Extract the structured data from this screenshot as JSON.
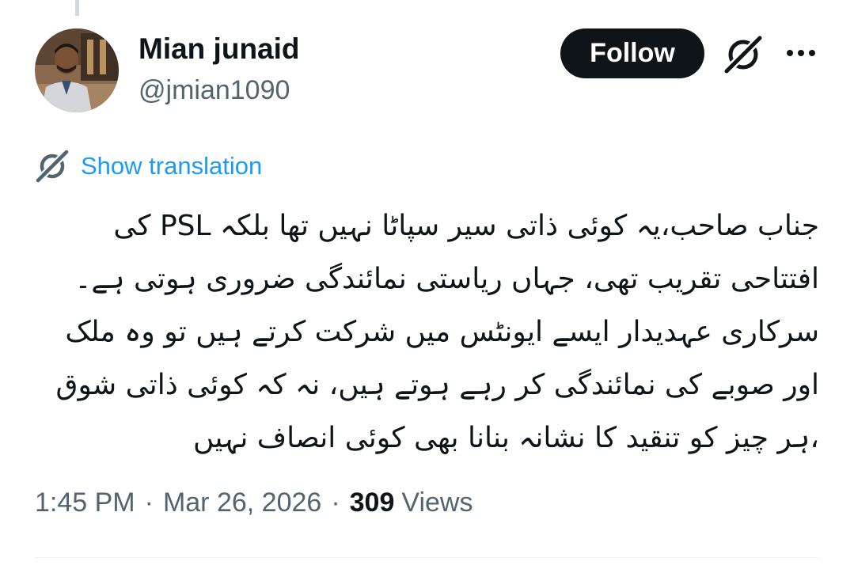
{
  "author": {
    "display_name": "Mian junaid",
    "handle": "@jmian1090"
  },
  "actions": {
    "follow_label": "Follow",
    "grok_icon": "grok-icon",
    "more_icon": "more-icon"
  },
  "translation": {
    "label": "Show translation",
    "icon": "translate-icon"
  },
  "tweet": {
    "lines": [
      "جناب صاحب،یہ کوئی ذاتی سیر سپاٹا نہیں تھا بلکہ PSL کی",
      "افتتاحی تقریب تھی، جہاں ریاستی نمائندگی ضروری ہوتی ہے۔",
      "سرکاری عہدیدار ایسے ایونٹس میں شرکت کرتے ہیں تو وہ ملک",
      "اور صوبے کی نمائندگی کر رہے ہوتے ہیں، نہ کہ کوئی ذاتی شوق",
      "،ہر چیز کو تنقید کا نشانہ بنانا بھی کوئی انصاف نہیں"
    ]
  },
  "meta": {
    "time": "1:45 PM",
    "separator": "·",
    "date": "Mar 26, 2026",
    "views_count": "309",
    "views_label": "Views"
  },
  "colors": {
    "text_primary": "#0f1419",
    "text_secondary": "#536471",
    "link": "#1d9bf0",
    "button_bg": "#0f1419",
    "button_text": "#ffffff"
  }
}
